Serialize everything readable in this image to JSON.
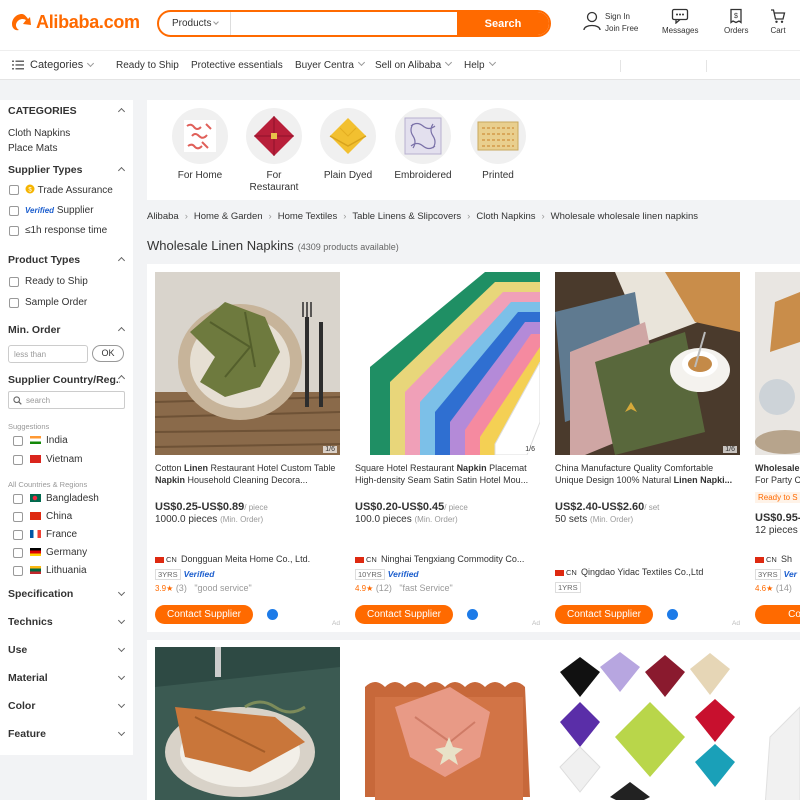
{
  "header": {
    "logo": "Alibaba.com",
    "search_category": "Products",
    "search_value": "",
    "search_button": "Search",
    "signin_line1": "Sign In",
    "signin_line2": "Join Free",
    "messages": "Messages",
    "orders": "Orders",
    "cart": "Cart"
  },
  "nav": {
    "categories": "Categories",
    "ready_to_ship": "Ready to Ship",
    "protective": "Protective essentials",
    "buyer_central": "Buyer Centra",
    "sell": "Sell on Alibaba",
    "help": "Help"
  },
  "sidebar": {
    "categories_title": "CATEGORIES",
    "categories": [
      "Cloth Napkins",
      "Place Mats"
    ],
    "supplier_types_title": "Supplier Types",
    "trade_assurance": "Trade Assurance",
    "verified_badge": "Verified",
    "verified_supplier": "Supplier",
    "response_time": "≤1h response time",
    "product_types_title": "Product Types",
    "ready_to_ship": "Ready to Ship",
    "sample_order": "Sample Order",
    "min_order_title": "Min. Order",
    "min_order_placeholder": "less than",
    "ok": "OK",
    "country_title": "Supplier Country/Reg...",
    "country_search_placeholder": "search",
    "suggestions_label": "Suggestions",
    "suggestions": [
      "India",
      "Vietnam"
    ],
    "all_countries_label": "All Countries & Regions",
    "countries": [
      "Bangladesh",
      "China",
      "France",
      "Germany",
      "Lithuania"
    ],
    "collapsed": [
      "Specification",
      "Technics",
      "Use",
      "Material",
      "Color",
      "Feature"
    ]
  },
  "category_tiles": [
    "For Home",
    "For Restaurant",
    "Plain Dyed",
    "Embroidered",
    "Printed"
  ],
  "breadcrumb": [
    "Alibaba",
    "Home & Garden",
    "Home Textiles",
    "Table Linens & Slipcovers",
    "Cloth Napkins",
    "Wholesale wholesale linen napkins"
  ],
  "page_title": "Wholesale Linen Napkins",
  "product_count": "(4309 products available)",
  "products": [
    {
      "img_count": "1/6",
      "title_pre": "Cotton ",
      "title_bold": "Linen",
      "title_mid": " Restaurant Hotel Custom Table ",
      "title_bold2": "Napkin",
      "title_post": " Household Cleaning Decora...",
      "price": "US$0.25-US$0.89",
      "unit": "/ piece",
      "moq": "1000.0 pieces",
      "moq_label": "(Min. Order)",
      "country": "CN",
      "supplier": "Dongguan Meita Home Co., Ltd.",
      "years": "3YRS",
      "verified": "Verified",
      "rating": "3.9",
      "reviews": "(3)",
      "review_tag": "\"good service\"",
      "contact": "Contact Supplier",
      "ad": "Ad"
    },
    {
      "img_count": "1/6",
      "title_pre": "Square Hotel Restaurant ",
      "title_bold": "Napkin",
      "title_mid": " Placemat High-density Seam Satin Satin Hotel Mou...",
      "title_bold2": "",
      "title_post": "",
      "price": "US$0.20-US$0.45",
      "unit": "/ piece",
      "moq": "100.0 pieces",
      "moq_label": "(Min. Order)",
      "country": "CN",
      "supplier": "Ninghai Tengxiang Commodity Co...",
      "years": "10YRS",
      "verified": "Verified",
      "rating": "4.9",
      "reviews": "(12)",
      "review_tag": "\"fast Service\"",
      "contact": "Contact Supplier",
      "ad": "Ad"
    },
    {
      "img_count": "1/6",
      "title_pre": "China Manufacture Quality Comfortable Unique Design 100% Natural ",
      "title_bold": "Linen",
      "title_mid": " ",
      "title_bold2": "Napki...",
      "title_post": "",
      "price": "US$2.40-US$2.60",
      "unit": "/ set",
      "moq": "50 sets",
      "moq_label": "(Min. Order)",
      "country": "CN",
      "supplier": "Qingdao Yidac Textiles Co.,Ltd",
      "years": "1YRS",
      "verified": "",
      "rating": "",
      "reviews": "",
      "review_tag": "",
      "contact": "Contact Supplier",
      "ad": "Ad"
    },
    {
      "img_count": "",
      "title_pre": "",
      "title_bold": "Wholesale",
      "title_mid": " For Party C",
      "title_bold2": "",
      "title_post": "",
      "ready_to_ship": "Ready to S",
      "price": "US$0.95-",
      "unit": "",
      "moq": "12 pieces",
      "moq_label": "",
      "country": "CN",
      "supplier": "Sh",
      "years": "3YRS",
      "verified": "Ver",
      "rating": "4.6",
      "reviews": "(14)",
      "review_tag": "",
      "contact": "Contac",
      "ad": ""
    }
  ],
  "colors": {
    "brand": "#ff6a00",
    "verified": "#1d5fce",
    "background": "#f2f3f5"
  }
}
